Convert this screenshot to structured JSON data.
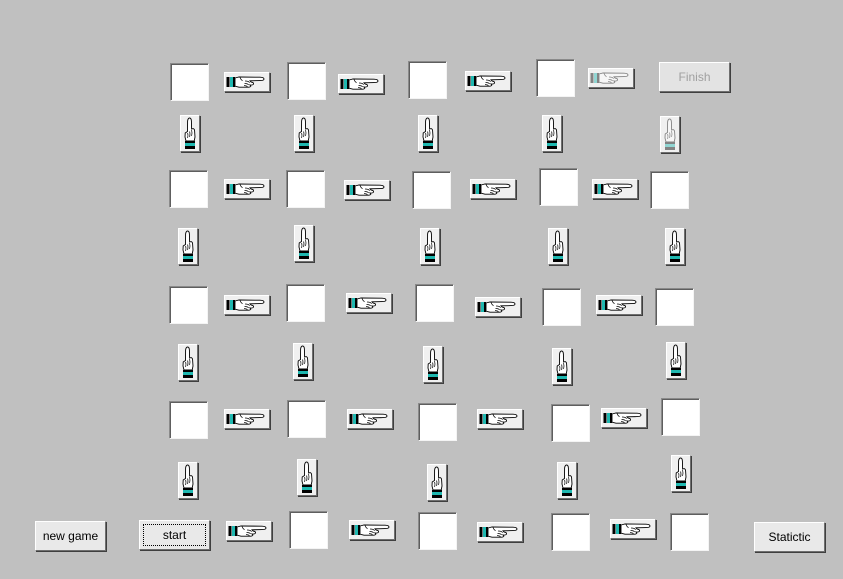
{
  "buttons": {
    "finish": "Finish",
    "new_game": "new game",
    "start": "start",
    "statistic": "Statictic"
  },
  "icons": {
    "horizontal": "pointing-right-hand-icon",
    "vertical": "pointing-up-hand-icon"
  },
  "colors": {
    "background": "#c0c0c0",
    "cell": "#ffffff",
    "cuff_accent": "#1fb8b0"
  }
}
